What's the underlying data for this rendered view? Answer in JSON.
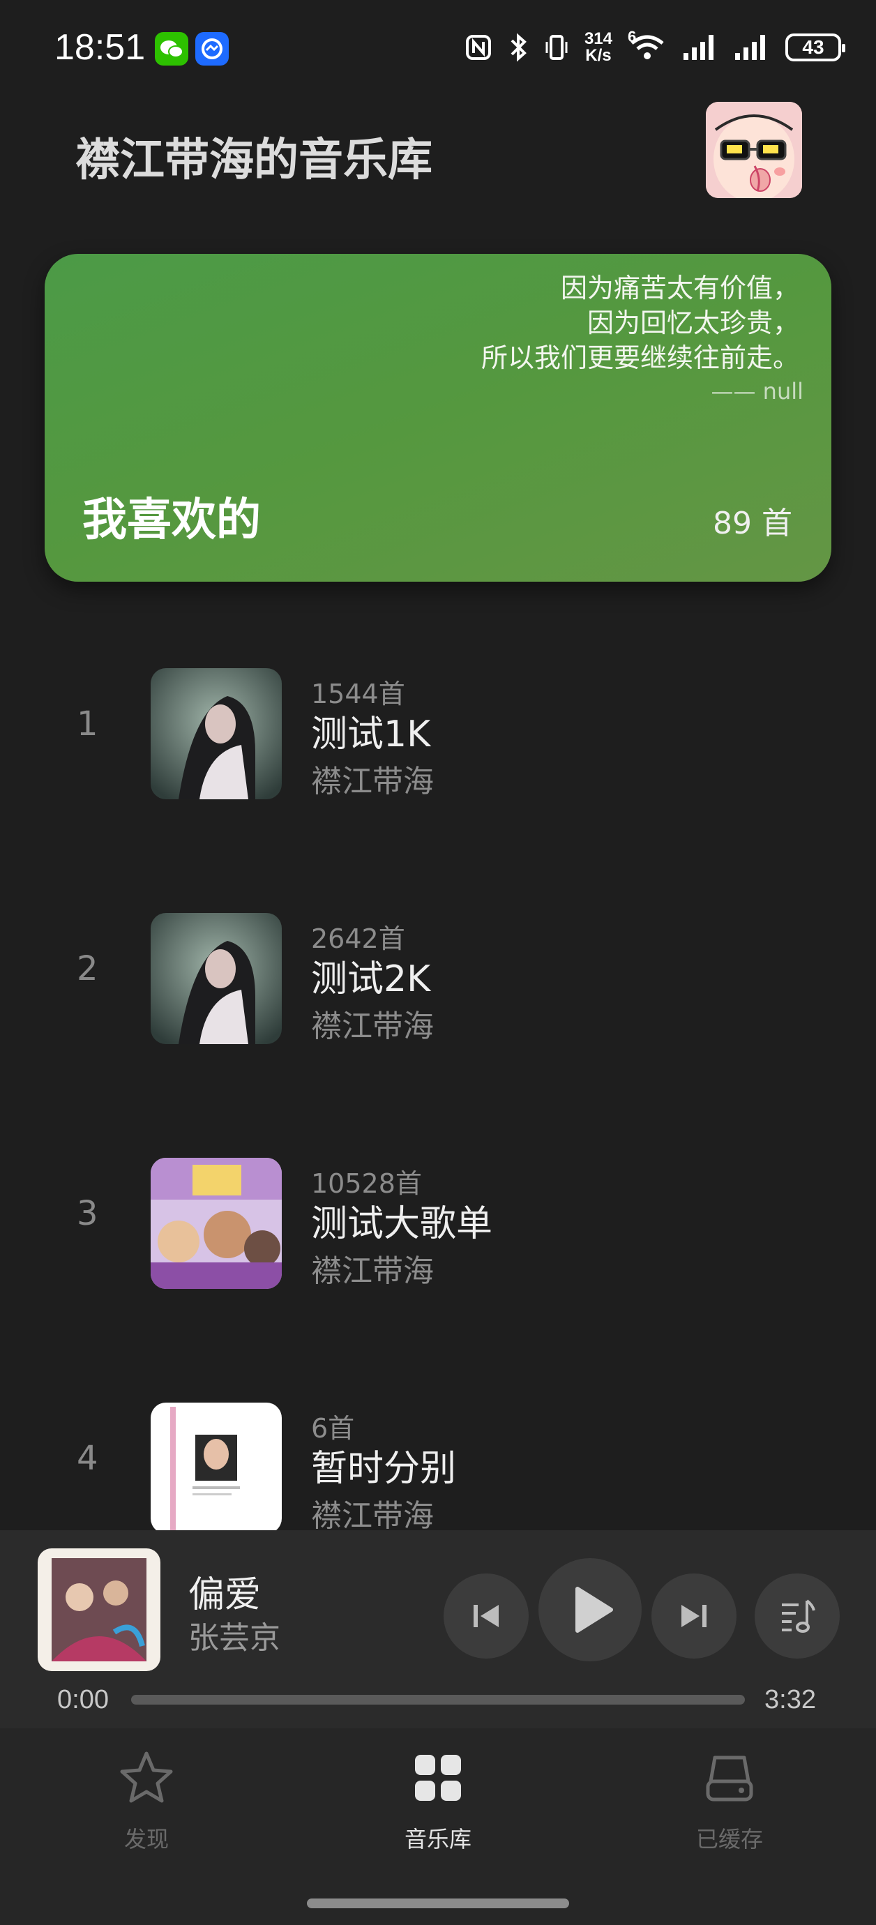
{
  "status": {
    "time": "18:51",
    "net_speed_value": "314",
    "net_speed_unit": "K/s",
    "network_type": "6",
    "battery": "43",
    "icons": [
      "wechat-icon",
      "qq-browser-icon",
      "nfc-icon",
      "bluetooth-icon",
      "vibrate-icon",
      "wifi-icon",
      "signal-icon",
      "signal-icon-2",
      "battery-icon"
    ]
  },
  "header": {
    "title": "襟江带海的音乐库"
  },
  "favorites": {
    "quote_line1": "因为痛苦太有价值，",
    "quote_line2": "因为回忆太珍贵，",
    "quote_line3": "所以我们更要继续往前走。",
    "quote_author": "—— null",
    "title": "我喜欢的",
    "count": "89 首"
  },
  "playlists": [
    {
      "index": "1",
      "count": "1544首",
      "name": "测试1K",
      "creator": "襟江带海"
    },
    {
      "index": "2",
      "count": "2642首",
      "name": "测试2K",
      "creator": "襟江带海"
    },
    {
      "index": "3",
      "count": "10528首",
      "name": "测试大歌单",
      "creator": "襟江带海"
    },
    {
      "index": "4",
      "count": "6首",
      "name": "暂时分别",
      "creator": "襟江带海"
    }
  ],
  "player": {
    "title": "偏爱",
    "artist": "张芸京",
    "current_time": "0:00",
    "total_time": "3:32",
    "progress": 0.0
  },
  "nav": [
    {
      "label": "发现",
      "icon": "star-icon",
      "active": false
    },
    {
      "label": "音乐库",
      "icon": "grid-icon",
      "active": true
    },
    {
      "label": "已缓存",
      "icon": "storage-icon",
      "active": false
    }
  ],
  "colors": {
    "background": "#1e1e1e",
    "card_green": "#55983f",
    "nav_active": "#e6e6e6",
    "nav_inactive": "#6a6a6a"
  }
}
